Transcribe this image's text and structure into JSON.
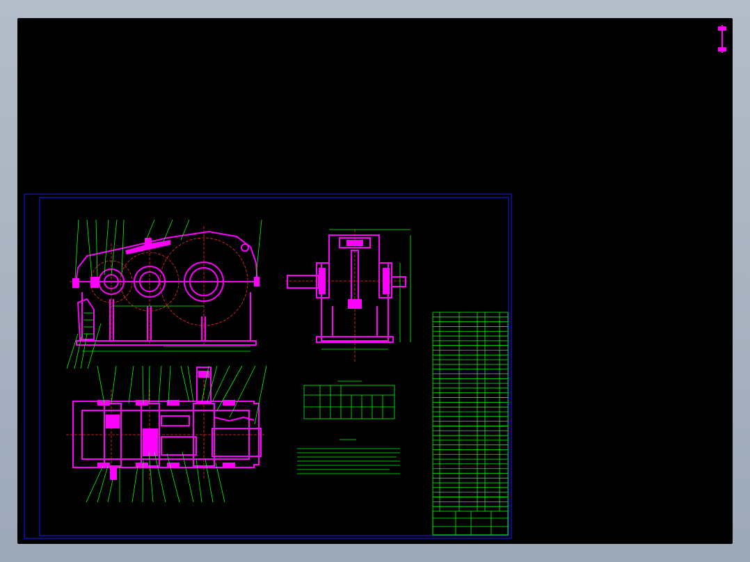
{
  "drawing": {
    "colors": {
      "background": "#000000",
      "geometry": "#ff00ff",
      "annotation": "#00ff00",
      "centerline": "#ff2a2a",
      "border": "#1a1aff"
    },
    "views": [
      "front-view",
      "side-view",
      "top-section-view",
      "parameter-table",
      "technical-requirements",
      "parts-list"
    ]
  }
}
